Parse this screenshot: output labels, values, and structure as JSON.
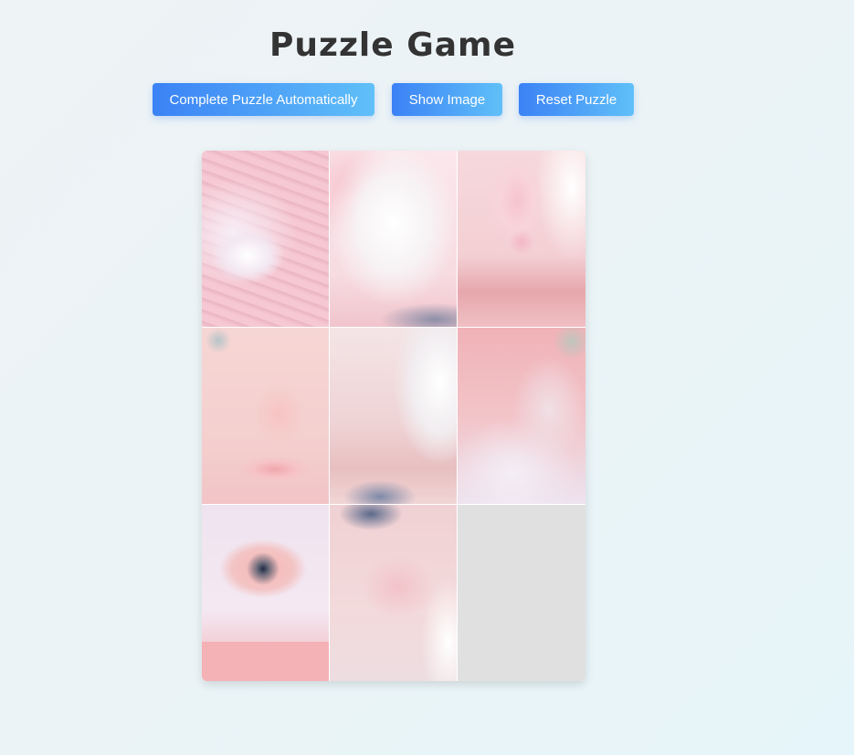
{
  "header": {
    "title": "Puzzle Game"
  },
  "toolbar": {
    "complete_label": "Complete Puzzle Automatically",
    "show_image_label": "Show Image",
    "reset_label": "Reset Puzzle"
  },
  "puzzle": {
    "grid": "3x3",
    "empty_tile_color": "#e0e0e0",
    "accent_gradient": [
      "#3b82f6",
      "#60c0f8"
    ]
  }
}
